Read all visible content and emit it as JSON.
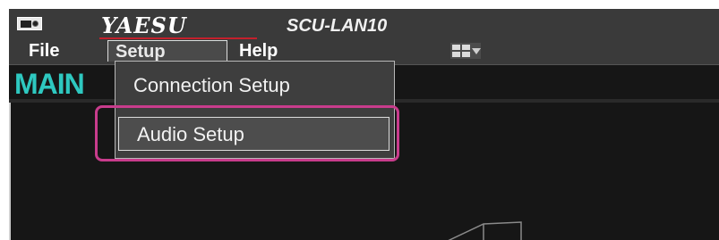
{
  "titlebar": {
    "brand": "YAESU",
    "model": "SCU-LAN10",
    "app_icon": "radio-icon"
  },
  "menubar": {
    "file": "File",
    "setup": "Setup",
    "help": "Help",
    "layout_icon": "layout-grid-icon"
  },
  "main": {
    "label": "MAIN"
  },
  "dropdown": {
    "items": [
      {
        "label": "Connection Setup"
      },
      {
        "label": "Audio Setup"
      }
    ]
  },
  "colors": {
    "background": "#3a3a3a",
    "main_label": "#2ec8c0",
    "highlight": "#c83c8c",
    "brand_line": "#c4202c"
  }
}
